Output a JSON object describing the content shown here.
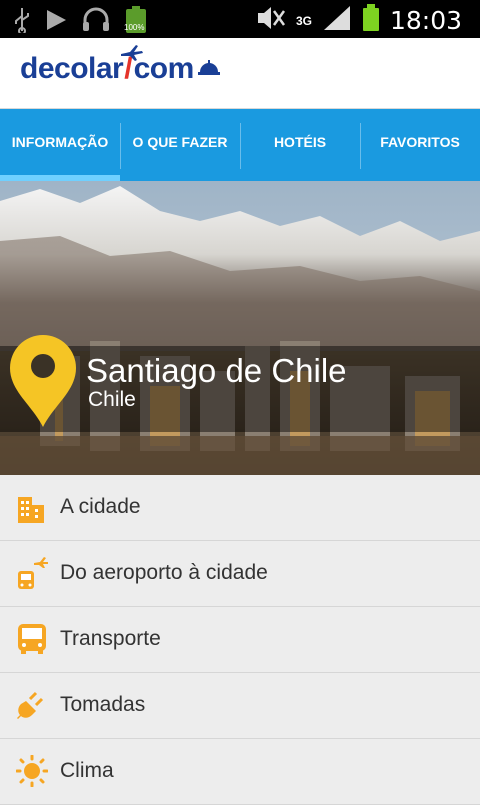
{
  "status_bar": {
    "battery_pct": "100%",
    "network": "3G",
    "time": "18:03"
  },
  "app": {
    "logo_part1": "decolar",
    "logo_part2": "com"
  },
  "tabs": [
    {
      "label": "INFORMAÇÃO",
      "active": true
    },
    {
      "label": "O QUE FAZER",
      "active": false
    },
    {
      "label": "HOTÉIS",
      "active": false
    },
    {
      "label": "FAVORITOS",
      "active": false
    }
  ],
  "destination": {
    "city": "Santiago de Chile",
    "country": "Chile"
  },
  "menu": [
    {
      "label": "A cidade",
      "icon": "building-icon"
    },
    {
      "label": "Do aeroporto à cidade",
      "icon": "airport-bus-icon"
    },
    {
      "label": "Transporte",
      "icon": "bus-icon"
    },
    {
      "label": "Tomadas",
      "icon": "plug-icon"
    },
    {
      "label": "Clima",
      "icon": "sun-icon"
    }
  ],
  "colors": {
    "tab_bar": "#1a9ae0",
    "tab_indicator": "#6fd0ff",
    "brand_blue": "#1a3f96",
    "brand_red": "#e5332a",
    "icon_orange": "#f6a623"
  }
}
